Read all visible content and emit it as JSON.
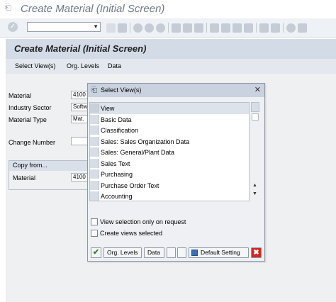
{
  "window": {
    "title": "Create Material (Initial Screen)"
  },
  "header": {
    "title": "Create Material (Initial Screen)"
  },
  "menu": {
    "items": [
      "Select View(s)",
      "Org. Levels",
      "Data"
    ]
  },
  "form": {
    "material_label": "Material",
    "material_value": "4100",
    "industry_label": "Industry Sector",
    "industry_value": "Softw",
    "type_label": "Material Type",
    "type_value": "Mat.",
    "change_label": "Change Number",
    "change_value": ""
  },
  "copy_from": {
    "title": "Copy from...",
    "material_label": "Material",
    "material_value": "4100"
  },
  "dialog": {
    "title": "Select View(s)",
    "column_header": "View",
    "views": [
      "Basic Data",
      "Classification",
      "Sales: Sales Organization Data",
      "Sales: General/Plant Data",
      "Sales Text",
      "Purchasing",
      "Purchase Order Text",
      "Accounting"
    ],
    "options": {
      "view_selection_only": "View selection only on request",
      "create_views_selected": "Create views selected"
    },
    "buttons": {
      "org_levels": "Org. Levels",
      "data": "Data",
      "default_setting": "Default Setting"
    }
  },
  "colors": {
    "title_band": "#d3dbe7",
    "dialog_title": "#c9d2de",
    "cancel_red": "#cf2a1f",
    "ok_green": "#2f8a1d"
  }
}
